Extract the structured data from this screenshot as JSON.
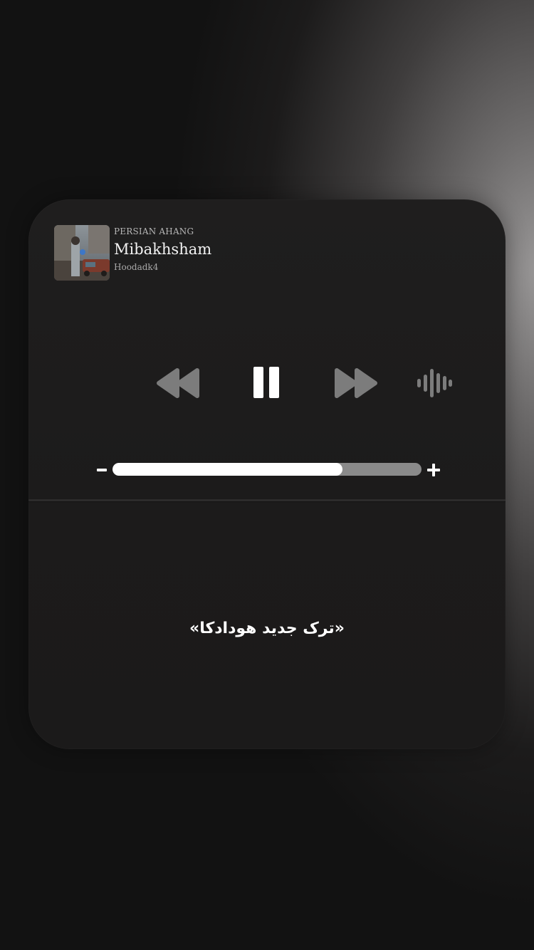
{
  "player": {
    "source": "PERSIAN AHANG",
    "title": "Mibakhsham",
    "artist": "Hoodadk4",
    "artwork": "album-cover"
  },
  "controls": {
    "rewind_icon": "rewind-icon",
    "pause_icon": "pause-icon",
    "forward_icon": "fast-forward-icon",
    "audio_icon": "waveform-icon"
  },
  "volume": {
    "minus_label": "-",
    "plus_label": "+",
    "level": 0.745
  },
  "caption": "«ترک جدید هودادکا»",
  "colors": {
    "card": "#1e1d1d",
    "controls_dim": "#7c7c7c",
    "controls_active": "#ffffff",
    "track": "#8a8a8a"
  }
}
